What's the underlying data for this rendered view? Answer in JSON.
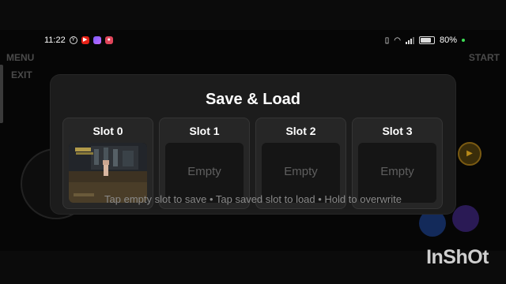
{
  "status_bar": {
    "time": "11:22",
    "battery": "80%",
    "battery_level": 0.8,
    "icons": [
      "y-app-icon",
      "youtube-icon",
      "photos-icon",
      "screen-record-icon",
      "vibrate-icon",
      "wifi-icon",
      "signal-icon",
      "battery-icon"
    ]
  },
  "emulator": {
    "menu_label": "MENU",
    "exit_label": "EXIT",
    "start_label": "START"
  },
  "dialog": {
    "title": "Save & Load",
    "slots": [
      {
        "label": "Slot 0",
        "state": "saved"
      },
      {
        "label": "Slot 1",
        "state": "Empty"
      },
      {
        "label": "Slot 2",
        "state": "Empty"
      },
      {
        "label": "Slot 3",
        "state": "Empty"
      }
    ],
    "hint": "Tap empty slot to save  •  Tap saved slot to load  •  Hold to overwrite"
  },
  "watermark": "InShOt",
  "colors": {
    "dialog_bg": "#1c1c1c",
    "slot_bg": "#262626",
    "empty_text": "#5f5f5f",
    "hint_text": "#8a8a8a",
    "battery_dot": "#3ddc55"
  }
}
